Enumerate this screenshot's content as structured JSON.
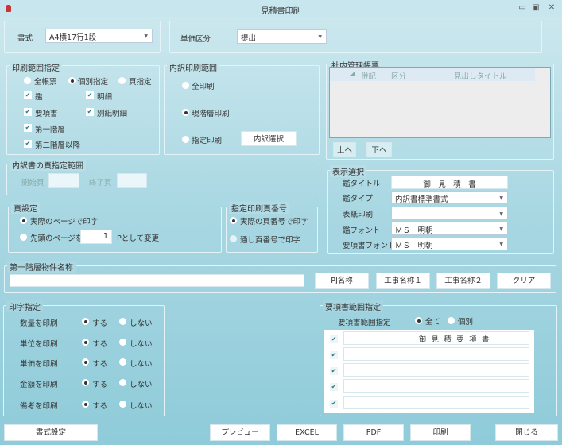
{
  "window": {
    "title": "見積書印刷"
  },
  "format": {
    "label": "書式",
    "value": "A4横17行1段"
  },
  "unit_price": {
    "label": "単価区分",
    "value": "提出"
  },
  "print_range": {
    "legend": "印刷範囲指定",
    "radios": [
      "全帳票",
      "個別指定",
      "頁指定"
    ],
    "selected": "個別指定",
    "checks": [
      {
        "label": "鑑",
        "checked": true
      },
      {
        "label": "明細",
        "checked": true
      },
      {
        "label": "要項書",
        "checked": true
      },
      {
        "label": "別紙明細",
        "checked": true
      },
      {
        "label": "第一階層",
        "checked": true
      },
      {
        "label": "第二階層以降",
        "checked": true
      }
    ]
  },
  "breakdown_range": {
    "legend": "内訳印刷範囲",
    "radios": [
      "全印刷",
      "現階層印刷",
      "指定印刷"
    ],
    "selected": "現階層印刷",
    "select_button": "内訳選択"
  },
  "internal": {
    "legend": "社内管理帳票",
    "columns": [
      "併記",
      "区分",
      "見出しタイトル"
    ],
    "up": "上へ",
    "down": "下へ"
  },
  "display": {
    "legend": "表示選択",
    "rows": [
      {
        "label": "鑑タイトル",
        "value": "御　見　積　書"
      },
      {
        "label": "鑑タイプ",
        "value": "内訳書標準書式"
      },
      {
        "label": "表紙印刷",
        "value": ""
      },
      {
        "label": "鑑フォント",
        "value": "ＭＳ　明朝"
      },
      {
        "label": "要項書フォント",
        "value": "ＭＳ　明朝"
      }
    ]
  },
  "page_range": {
    "legend": "内訳書の頁指定範囲",
    "start_label": "開始頁",
    "start": "",
    "end_label": "終了頁",
    "end": ""
  },
  "page_setting": {
    "legend": "頁設定",
    "opt1": "実際のページで印字",
    "opt2": "先頭のページを",
    "first_page": "1",
    "opt2_suffix": "Pとして変更"
  },
  "page_number": {
    "legend": "指定印刷頁番号",
    "opt1": "実際の頁番号で印字",
    "opt2": "通し頁番号で印字"
  },
  "project_name": {
    "legend": "第一階層物件名称",
    "value": "",
    "buttons": [
      "PJ名称",
      "工事名称１",
      "工事名称２",
      "クリア"
    ]
  },
  "print_spec": {
    "legend": "印字指定",
    "yes": "する",
    "no": "しない",
    "rows": [
      "数量を印刷",
      "単位を印刷",
      "単価を印刷",
      "金額を印刷",
      "備考を印刷"
    ]
  },
  "summary_range": {
    "legend": "要項書範囲指定",
    "label": "要項書範囲指定",
    "all": "全て",
    "each": "個別",
    "items": [
      "御 見 積 要 項 書",
      "",
      "",
      "",
      ""
    ]
  },
  "footer": {
    "format_settings": "書式設定",
    "preview": "プレビュー",
    "excel": "EXCEL",
    "pdf": "PDF",
    "print": "印刷",
    "close": "閉じる"
  }
}
